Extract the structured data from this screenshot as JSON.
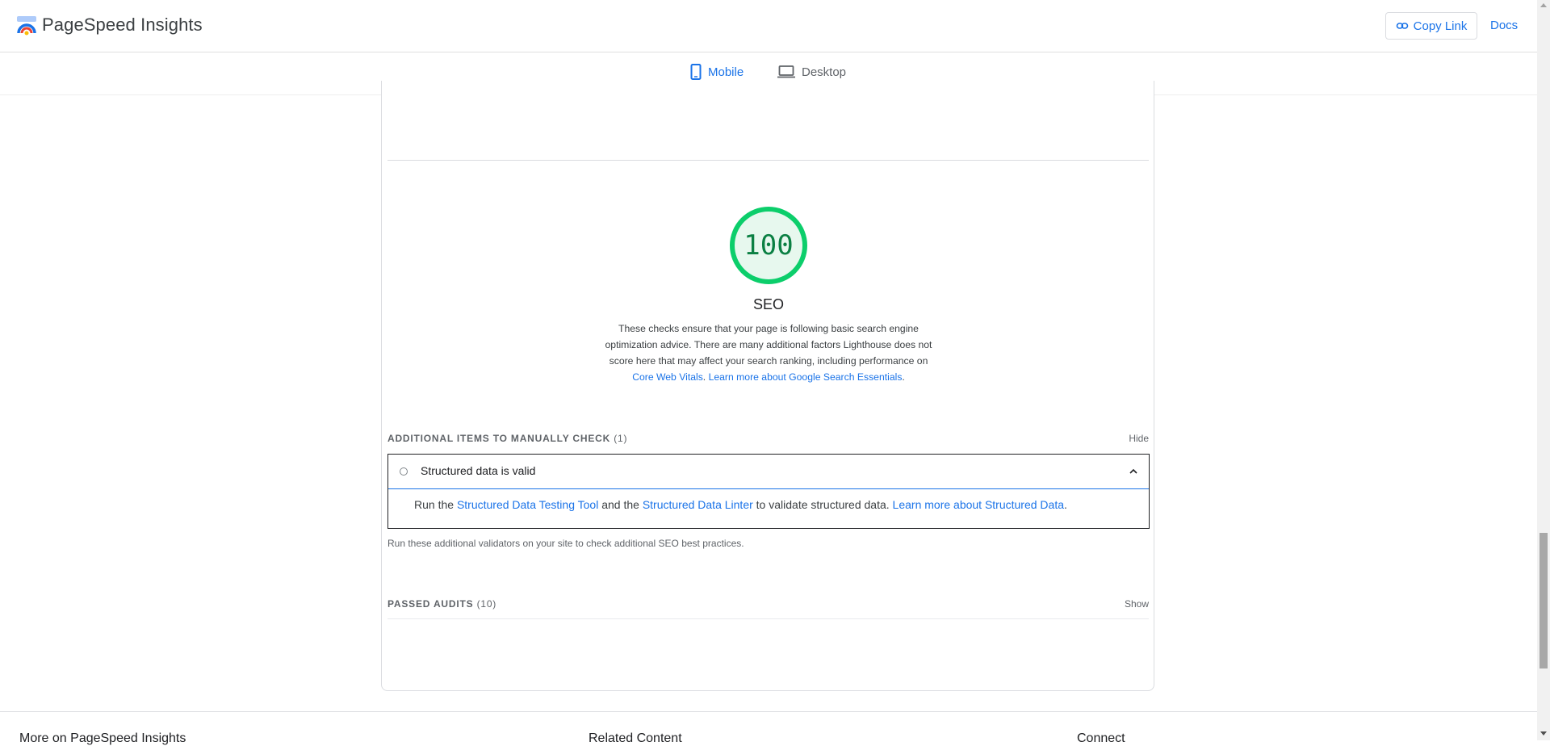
{
  "header": {
    "app_title": "PageSpeed Insights",
    "copy_link_label": "Copy Link",
    "docs_label": "Docs"
  },
  "tabs": [
    {
      "label": "Mobile",
      "icon": "smartphone-icon",
      "active": true
    },
    {
      "label": "Desktop",
      "icon": "laptop-icon",
      "active": false
    }
  ],
  "category": {
    "score": "100",
    "score_color": "#0cce6b",
    "title": "SEO",
    "desc_text": "These checks ensure that your page is following basic search engine optimization advice. There are many additional factors Lighthouse does not score here that may affect your search ranking, including performance on ",
    "desc_link1": "Core Web Vitals",
    "desc_sep": ". ",
    "desc_link2": "Learn more about Google Search Essentials",
    "desc_end": "."
  },
  "manual_group": {
    "title": "ADDITIONAL ITEMS TO MANUALLY CHECK",
    "count": "(1)",
    "toggle": "Hide",
    "audit_title": "Structured data is valid",
    "audit_desc_1": "Run the ",
    "audit_link_1": "Structured Data Testing Tool",
    "audit_desc_2": " and the ",
    "audit_link_2": "Structured Data Linter",
    "audit_desc_3": " to validate structured data. ",
    "audit_link_3": "Learn more about Structured Data",
    "audit_desc_4": ".",
    "group_desc": "Run these additional validators on your site to check additional SEO best practices."
  },
  "passed_group": {
    "title": "PASSED AUDITS",
    "count": "(10)",
    "toggle": "Show"
  },
  "footer": {
    "headings": [
      "More on PageSpeed Insights",
      "Related Content",
      "Connect"
    ]
  }
}
